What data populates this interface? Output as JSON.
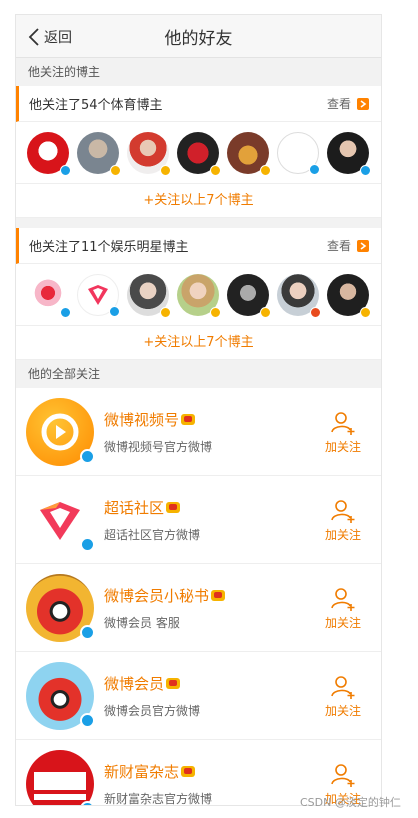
{
  "header": {
    "back_label": "返回",
    "title": "他的好友"
  },
  "section1": {
    "title": "他关注的博主",
    "groups": [
      {
        "bar_title": "他关注了54个体育博主",
        "see_label": "查看",
        "more_label": "+关注以上7个博主"
      },
      {
        "bar_title": "他关注了11个娱乐明星博主",
        "see_label": "查看",
        "more_label": "+关注以上7个博主"
      }
    ]
  },
  "section2": {
    "title": "他的全部关注",
    "items": [
      {
        "name": "微博视频号",
        "desc": "微博视频号官方微博",
        "add_label": "加关注"
      },
      {
        "name": "超话社区",
        "desc": "超话社区官方微博",
        "add_label": "加关注"
      },
      {
        "name": "微博会员小秘书",
        "desc": "微博会员 客服",
        "add_label": "加关注"
      },
      {
        "name": "微博会员",
        "desc": "微博会员官方微博",
        "add_label": "加关注"
      },
      {
        "name": "新财富杂志",
        "desc": "新财富杂志官方微博",
        "add_label": "加关注"
      }
    ]
  },
  "watermark": "CSDN @淡定的钟仁",
  "colors": {
    "accent": "#ff8200",
    "link": "#f07c00",
    "vblue": "#1a9fe6",
    "gold": "#f6b300"
  }
}
